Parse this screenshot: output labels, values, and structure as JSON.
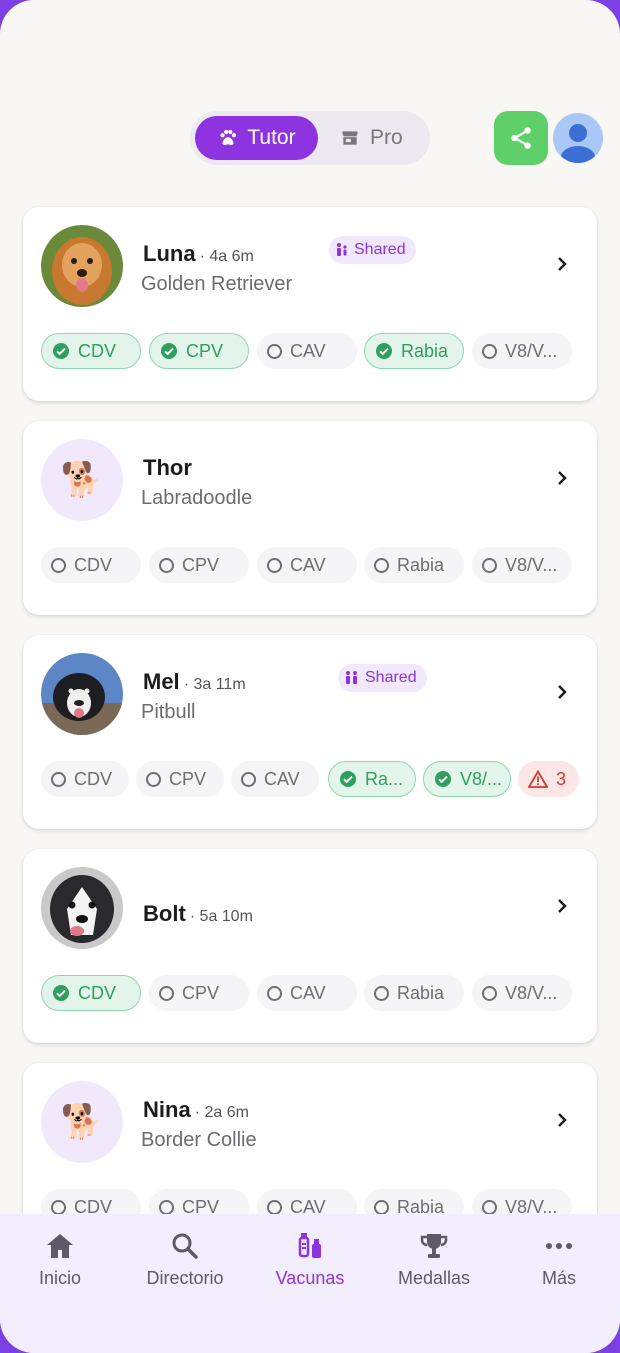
{
  "header": {
    "mode_tutor": "Tutor",
    "mode_pro": "Pro"
  },
  "pets": [
    {
      "name": "Luna",
      "age": "· 4a 6m",
      "breed": "Golden Retriever",
      "shared": "Shared",
      "vaccines": [
        {
          "label": "CDV",
          "done": true
        },
        {
          "label": "CPV",
          "done": true
        },
        {
          "label": "CAV",
          "done": false
        },
        {
          "label": "Rabia",
          "done": true
        },
        {
          "label": "V8/V...",
          "done": false
        }
      ]
    },
    {
      "name": "Thor",
      "age": "",
      "breed": "Labradoodle",
      "shared": "",
      "vaccines": [
        {
          "label": "CDV",
          "done": false
        },
        {
          "label": "CPV",
          "done": false
        },
        {
          "label": "CAV",
          "done": false
        },
        {
          "label": "Rabia",
          "done": false
        },
        {
          "label": "V8/V...",
          "done": false
        }
      ]
    },
    {
      "name": "Mel",
      "age": "· 3a 11m",
      "breed": "Pitbull",
      "shared": "Shared",
      "vaccines": [
        {
          "label": "CDV",
          "done": false
        },
        {
          "label": "CPV",
          "done": false
        },
        {
          "label": "CAV",
          "done": false
        },
        {
          "label": "Ra...",
          "done": true
        },
        {
          "label": "V8/...",
          "done": true
        }
      ],
      "alert_count": "3"
    },
    {
      "name": "Bolt",
      "age": "· 5a 10m",
      "breed": "",
      "shared": "",
      "vaccines": [
        {
          "label": "CDV",
          "done": true
        },
        {
          "label": "CPV",
          "done": false
        },
        {
          "label": "CAV",
          "done": false
        },
        {
          "label": "Rabia",
          "done": false
        },
        {
          "label": "V8/V...",
          "done": false
        }
      ]
    },
    {
      "name": "Nina",
      "age": "· 2a 6m",
      "breed": "Border Collie",
      "shared": "",
      "vaccines": [
        {
          "label": "CDV",
          "done": false
        },
        {
          "label": "CPV",
          "done": false
        },
        {
          "label": "CAV",
          "done": false
        },
        {
          "label": "Rabia",
          "done": false
        },
        {
          "label": "V8/V...",
          "done": false
        }
      ]
    }
  ],
  "nav": {
    "items": [
      {
        "label": "Inicio",
        "icon": "home-icon"
      },
      {
        "label": "Directorio",
        "icon": "search-icon"
      },
      {
        "label": "Vacunas",
        "icon": "vaccine-icon"
      },
      {
        "label": "Medallas",
        "icon": "trophy-icon"
      },
      {
        "label": "Más",
        "icon": "more-icon"
      }
    ],
    "active": "Vacunas"
  },
  "colors": {
    "accent": "#8E33E0",
    "success": "#2E9F5E",
    "share": "#5FCF6A",
    "warning": "#D33A3A"
  }
}
